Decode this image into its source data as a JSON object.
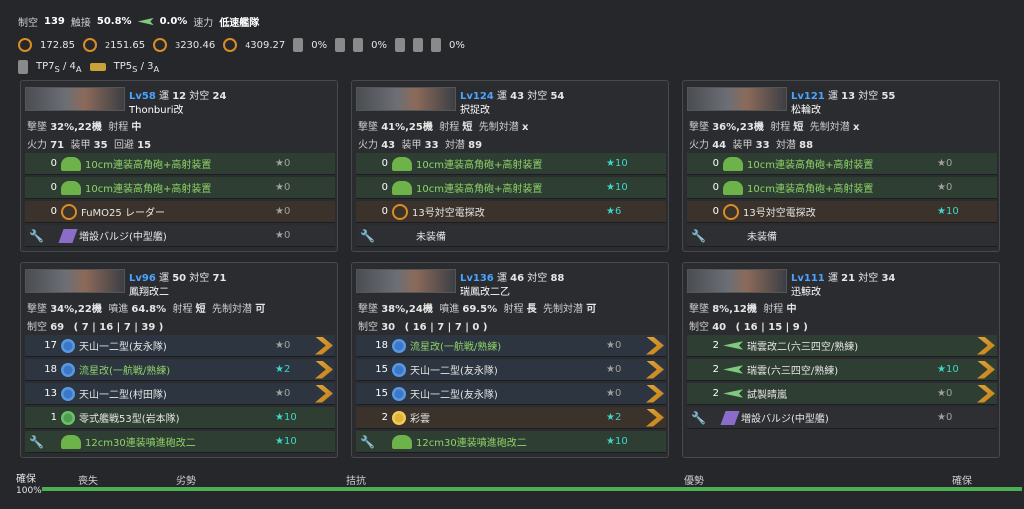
{
  "summary": {
    "air_label": "制空",
    "air": "139",
    "evade_label": "触接",
    "evade": "50.8%",
    "aa_pct": "0.0%",
    "speed_label": "速力",
    "speed": "低速艦隊",
    "los": [
      "172.85",
      "151.65",
      "230.46",
      "309.27"
    ],
    "los_subs": [
      "",
      "2",
      "3",
      "4"
    ],
    "drum1": "0%",
    "drum2": "0%",
    "drum3": "0%",
    "tp_s": "7",
    "tp_a": "4",
    "tp2_s": "5",
    "tp2_a": "3"
  },
  "ships": [
    {
      "lv": "Lv58",
      "luck_label": "運",
      "luck": "12",
      "aa_label": "対空",
      "aa": "24",
      "name": "Thonburi改",
      "l1": [
        [
          "撃墜",
          "32%,22機"
        ],
        [
          "射程",
          "中"
        ]
      ],
      "l2": [
        [
          "火力",
          "71"
        ],
        [
          "装甲",
          "35"
        ],
        [
          "回避",
          "15"
        ]
      ],
      "slots": [
        [
          "0",
          "gun",
          "10cm連装高角砲+高射装置",
          "★0",
          "0",
          "green"
        ],
        [
          "0",
          "gun",
          "10cm連装高角砲+高射装置",
          "★0",
          "0",
          "green"
        ],
        [
          "0",
          "radar",
          "FuMO25 レーダー",
          "★0",
          "0",
          "brown"
        ],
        [
          "",
          "bulge",
          "増設バルジ(中型艦)",
          "★0",
          "0",
          "gray"
        ]
      ]
    },
    {
      "lv": "Lv124",
      "luck_label": "運",
      "luck": "43",
      "aa_label": "対空",
      "aa": "54",
      "name": "択捉改",
      "l1": [
        [
          "撃墜",
          "41%,25機"
        ],
        [
          "射程",
          "短"
        ],
        [
          "先制対潜",
          "x"
        ]
      ],
      "l2": [
        [
          "火力",
          "43"
        ],
        [
          "装甲",
          "33"
        ],
        [
          "対潜",
          "89"
        ]
      ],
      "slots": [
        [
          "0",
          "gun",
          "10cm連装高角砲+高射装置",
          "★10",
          "1",
          "green"
        ],
        [
          "0",
          "gun",
          "10cm連装高角砲+高射装置",
          "★10",
          "1",
          "green"
        ],
        [
          "0",
          "radar",
          "13号対空電探改",
          "★6",
          "1",
          "brown"
        ],
        [
          "",
          "none",
          "未装備",
          "",
          "0",
          "gray"
        ]
      ]
    },
    {
      "lv": "Lv121",
      "luck_label": "運",
      "luck": "13",
      "aa_label": "対空",
      "aa": "55",
      "name": "松輪改",
      "l1": [
        [
          "撃墜",
          "36%,23機"
        ],
        [
          "射程",
          "短"
        ],
        [
          "先制対潜",
          "x"
        ]
      ],
      "l2": [
        [
          "火力",
          "44"
        ],
        [
          "装甲",
          "33"
        ],
        [
          "対潜",
          "88"
        ]
      ],
      "slots": [
        [
          "0",
          "gun",
          "10cm連装高角砲+高射装置",
          "★0",
          "0",
          "green"
        ],
        [
          "0",
          "gun",
          "10cm連装高角砲+高射装置",
          "★0",
          "0",
          "green"
        ],
        [
          "0",
          "radar",
          "13号対空電探改",
          "★10",
          "1",
          "brown"
        ],
        [
          "",
          "none",
          "未装備",
          "",
          "0",
          "gray"
        ]
      ]
    },
    {
      "lv": "Lv96",
      "luck_label": "運",
      "luck": "50",
      "aa_label": "対空",
      "aa": "71",
      "name": "鳳翔改二",
      "l1": [
        [
          "撃墜",
          "34%,22機"
        ],
        [
          "噴進",
          "64.8%"
        ],
        [
          "射程",
          "短"
        ],
        [
          "先制対潜",
          "可"
        ]
      ],
      "l2": [
        [
          "制空",
          "69"
        ],
        [
          "",
          "( 7 | 16 | 7 | 39 )"
        ]
      ],
      "slots": [
        [
          "17",
          "plane-b",
          "天山一二型(友永隊)",
          "★0",
          "0",
          "blue"
        ],
        [
          "18",
          "plane-b",
          "流星改(一航戦/熟練)",
          "★2",
          "1",
          "blue"
        ],
        [
          "13",
          "plane-b",
          "天山一二型(村田隊)",
          "★0",
          "0",
          "blue"
        ],
        [
          "1",
          "plane-gr",
          "零式艦戦53型(岩本隊)",
          "★10",
          "1",
          "green"
        ],
        [
          "",
          "gun",
          "12cm30連装噴進砲改二",
          "★10",
          "1",
          "green"
        ]
      ]
    },
    {
      "lv": "Lv136",
      "luck_label": "運",
      "luck": "46",
      "aa_label": "対空",
      "aa": "88",
      "name": "瑞鳳改二乙",
      "l1": [
        [
          "撃墜",
          "38%,24機"
        ],
        [
          "噴進",
          "69.5%"
        ],
        [
          "射程",
          "長"
        ],
        [
          "先制対潜",
          "可"
        ]
      ],
      "l2": [
        [
          "制空",
          "30"
        ],
        [
          "",
          "( 16 | 7 | 7 | 0 )"
        ]
      ],
      "slots": [
        [
          "18",
          "plane-b",
          "流星改(一航戦/熟練)",
          "★0",
          "0",
          "blue"
        ],
        [
          "15",
          "plane-b",
          "天山一二型(友永隊)",
          "★0",
          "0",
          "blue"
        ],
        [
          "15",
          "plane-b",
          "天山一二型(友永隊)",
          "★0",
          "0",
          "blue"
        ],
        [
          "2",
          "plane-y",
          "彩雲",
          "★2",
          "1",
          "brown"
        ],
        [
          "",
          "gun",
          "12cm30連装噴進砲改二",
          "★10",
          "1",
          "green"
        ]
      ]
    },
    {
      "lv": "Lv111",
      "luck_label": "運",
      "luck": "21",
      "aa_label": "対空",
      "aa": "34",
      "name": "迅鯨改",
      "l1": [
        [
          "撃墜",
          "8%,12機"
        ],
        [
          "射程",
          "中"
        ]
      ],
      "l2": [
        [
          "制空",
          "40"
        ],
        [
          "",
          "( 16 | 15 | 9 )"
        ]
      ],
      "slots": [
        [
          "2",
          "plane-g",
          "瑞雲改二(六三四空/熟練)",
          "",
          "0",
          "green"
        ],
        [
          "2",
          "plane-g",
          "瑞雲(六三四空/熟練)",
          "★10",
          "1",
          "green"
        ],
        [
          "2",
          "plane-g",
          "試製晴嵐",
          "★0",
          "0",
          "green"
        ],
        [
          "",
          "bulge",
          "増設バルジ(中型艦)",
          "★0",
          "0",
          "gray"
        ]
      ]
    }
  ],
  "air_state": {
    "left_label": "確保",
    "left_pct": "100%",
    "ticks": [
      "喪失",
      "劣勢",
      "拮抗",
      "優勢",
      "確保"
    ]
  }
}
